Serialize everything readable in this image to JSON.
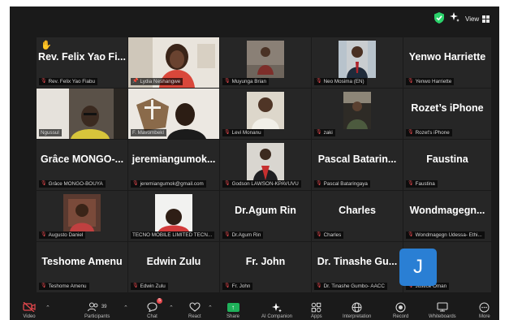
{
  "topbar": {
    "view_label": "View"
  },
  "tiles": [
    {
      "display": "Rev. Felix Yao Fi...",
      "label": "Rev. Felix Yao Fiabu",
      "muted": true,
      "hand_raised": true
    },
    {
      "display": "",
      "label": "Lydia Neshangwe",
      "muted": false,
      "pinned": true,
      "speaking": true
    },
    {
      "display": "",
      "label": "Muyunga Brian",
      "muted": true
    },
    {
      "display": "",
      "label": "Neo Mosima (EN)",
      "muted": true
    },
    {
      "display": "Yenwo Harriette",
      "label": "Yenwo Harriette",
      "muted": true
    },
    {
      "display": "",
      "label": "Ngussul",
      "muted": false
    },
    {
      "display": "",
      "label": "F. Mavombekl",
      "muted": false
    },
    {
      "display": "",
      "label": "Levi Monanu",
      "muted": true
    },
    {
      "display": "",
      "label": "zaki",
      "muted": true
    },
    {
      "display": "Rozet’s iPhone",
      "label": "Rozet's iPhone",
      "muted": true
    },
    {
      "display": "Grâce MONGO-...",
      "label": "Grâce MONGO-BOUYA",
      "muted": true
    },
    {
      "display": "jeremiangumok...",
      "label": "jeremiangumok@gmail.com",
      "muted": true
    },
    {
      "display": "",
      "label": "Godson LAWSON-KPAVUVU",
      "muted": true
    },
    {
      "display": "Pascal Batarin...",
      "label": "Pascal Bataringaya",
      "muted": true
    },
    {
      "display": "Faustina",
      "label": "Faustina",
      "muted": true
    },
    {
      "display": "",
      "label": "Augusto Daniel",
      "muted": true
    },
    {
      "display": "",
      "label": "TECNO MOBILE LIMITED TECN...",
      "muted": false
    },
    {
      "display": "Dr.Agum Rin",
      "label": "Dr.Agum Rin",
      "muted": true
    },
    {
      "display": "Charles",
      "label": "Charles",
      "muted": true
    },
    {
      "display": "Wondmagegn...",
      "label": "Wondmagegn Udessa- Ethi...",
      "muted": true
    },
    {
      "display": "Teshome Amenu",
      "label": "Teshome Amenu",
      "muted": true
    },
    {
      "display": "Edwin Zulu",
      "label": "Edwin Zulu",
      "muted": true
    },
    {
      "display": "Fr. John",
      "label": "Fr. John",
      "muted": true
    },
    {
      "display": "Dr. Tinashe Gu...",
      "label": "Dr. Tinashe Gumbo- AACC",
      "muted": true
    },
    {
      "display": "",
      "label": "Justice Oman",
      "muted": true,
      "avatar_letter": "J"
    }
  ],
  "toolbar": {
    "participants_count": "39",
    "chat_badge": "5",
    "items": [
      {
        "label": "Video",
        "icon": "video-off-icon"
      },
      {
        "label": "Participants",
        "icon": "participants-icon"
      },
      {
        "label": "Chat",
        "icon": "chat-icon"
      },
      {
        "label": "React",
        "icon": "react-icon"
      },
      {
        "label": "Share",
        "icon": "share-icon"
      },
      {
        "label": "AI Companion",
        "icon": "ai-companion-icon"
      },
      {
        "label": "Apps",
        "icon": "apps-icon"
      },
      {
        "label": "Interpretation",
        "icon": "interpretation-icon"
      },
      {
        "label": "Record",
        "icon": "record-icon"
      },
      {
        "label": "Whiteboards",
        "icon": "whiteboard-icon"
      },
      {
        "label": "More",
        "icon": "more-icon"
      }
    ]
  },
  "colors": {
    "speaker_outline": "#2bd26b",
    "muted_mic": "#e5484d",
    "share_green": "#1fb15a",
    "avatar_blue": "#2a7fd4"
  }
}
